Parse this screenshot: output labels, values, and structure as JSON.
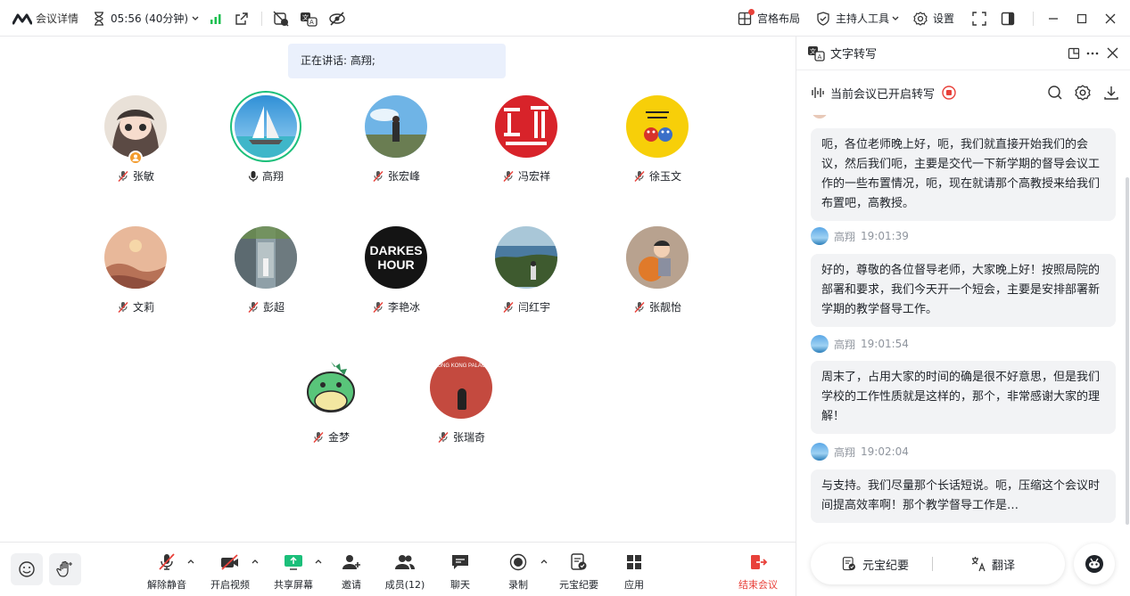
{
  "topbar": {
    "meeting_info": "会议详情",
    "timer": "05:56 (40分钟)",
    "layout": "宫格布局",
    "host_tools": "主持人工具",
    "settings": "设置"
  },
  "speaking": "正在讲话: 高翔;",
  "participants": [
    {
      "name": "张敏",
      "muted": true
    },
    {
      "name": "高翔",
      "muted": false
    },
    {
      "name": "张宏峰",
      "muted": true
    },
    {
      "name": "冯宏祥",
      "muted": true
    },
    {
      "name": "徐玉文",
      "muted": true
    },
    {
      "name": "文莉",
      "muted": true
    },
    {
      "name": "彭超",
      "muted": true
    },
    {
      "name": "李艳冰",
      "muted": true
    },
    {
      "name": "闫红宇",
      "muted": true
    },
    {
      "name": "张靓怡",
      "muted": true
    },
    {
      "name": "金梦",
      "muted": true
    },
    {
      "name": "张瑞奇",
      "muted": true
    }
  ],
  "avatar_text": {
    "lixu": "DARKES\nHOUR",
    "ruiqi": "GONG KONG PALACE"
  },
  "bottombar": {
    "unmute": "解除静音",
    "video": "开启视频",
    "share": "共享屏幕",
    "invite": "邀请",
    "members": "成员(12)",
    "chat": "聊天",
    "record": "录制",
    "yuanbao": "元宝纪要",
    "apps": "应用",
    "end": "结束会议"
  },
  "sidebar": {
    "title": "文字转写",
    "status": "当前会议已开启转写",
    "messages": [
      {
        "speaker": "",
        "time": "",
        "text": "呃，各位老师晚上好，呃，我们就直接开始我们的会议，然后我们呃，主要是交代一下新学期的督导会议工作的一些布置情况，呃，现在就请那个高教授来给我们布置吧，高教授。"
      },
      {
        "speaker": "高翔",
        "time": "19:01:39",
        "text": "好的，尊敬的各位督导老师，大家晚上好！按照局院的部署和要求，我们今天开一个短会，主要是安排部署新学期的教学督导工作。"
      },
      {
        "speaker": "高翔",
        "time": "19:01:54",
        "text": "周末了，占用大家的时间的确是很不好意思，但是我们学校的工作性质就是这样的，那个，非常感谢大家的理解！"
      },
      {
        "speaker": "高翔",
        "time": "19:02:04",
        "text": "与支持。我们尽量那个长话短说。呃，压缩这个会议时间提高效率啊！那个教学督导工作是…"
      }
    ],
    "yuanbao_btn": "元宝纪要",
    "translate_btn": "翻译"
  },
  "colors": {
    "accent_green": "#1bbf7a",
    "red": "#e8413a",
    "speaking_bg": "#eaf0fc",
    "signal": "#1bbf4f"
  }
}
